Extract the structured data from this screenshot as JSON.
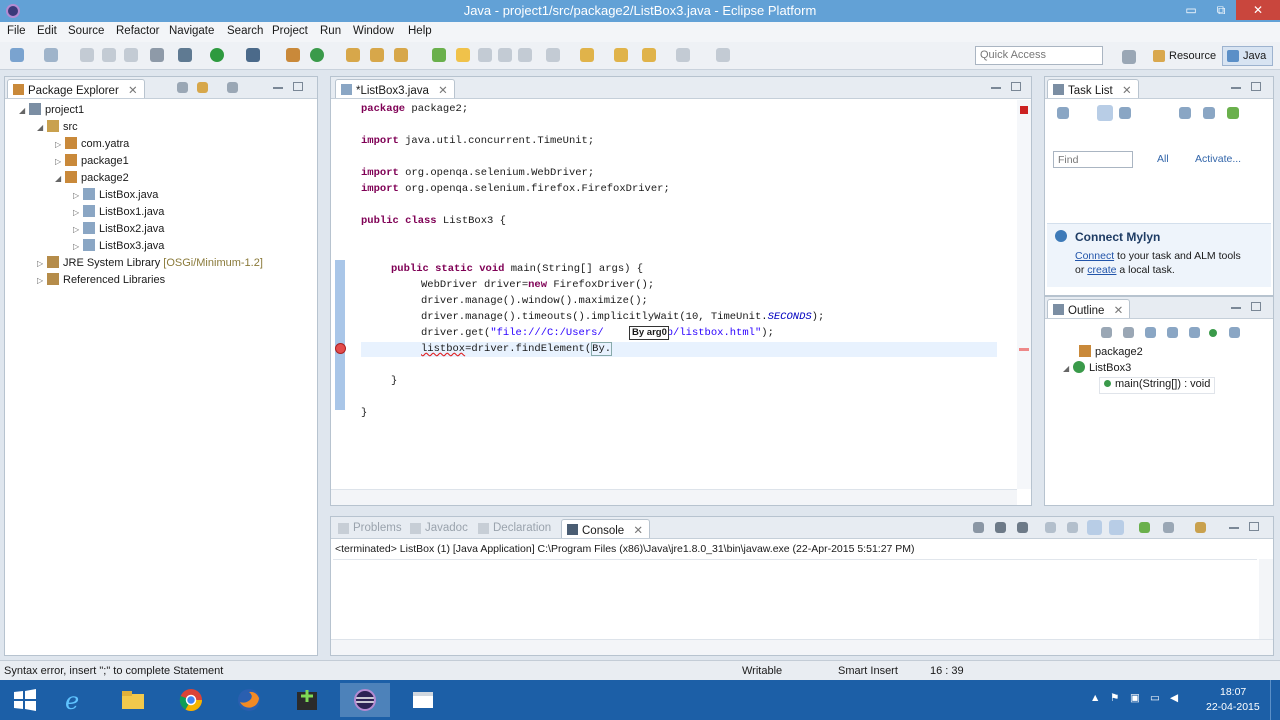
{
  "window": {
    "title": "Java - project1/src/package2/ListBox3.java - Eclipse Platform",
    "minimize": "▭",
    "maximize": "⧉",
    "close": "✕"
  },
  "menu": [
    "File",
    "Edit",
    "Source",
    "Refactor",
    "Navigate",
    "Search",
    "Project",
    "Run",
    "Window",
    "Help"
  ],
  "toolbar": {
    "quick_access_placeholder": "Quick Access",
    "perspectives": [
      "Resource",
      "Java"
    ]
  },
  "package_explorer": {
    "title": "Package Explorer",
    "tree": [
      {
        "label": "project1",
        "arrow": "◢"
      },
      {
        "label": "src",
        "arrow": "◢"
      },
      {
        "label": "com.yatra",
        "arrow": "▷"
      },
      {
        "label": "package1",
        "arrow": "▷"
      },
      {
        "label": "package2",
        "arrow": "◢"
      },
      {
        "label": "ListBox.java",
        "arrow": "▷"
      },
      {
        "label": "ListBox1.java",
        "arrow": "▷"
      },
      {
        "label": "ListBox2.java",
        "arrow": "▷"
      },
      {
        "label": "ListBox3.java",
        "arrow": "▷"
      },
      {
        "label": "JRE System Library",
        "decoration": "[OSGi/Minimum-1.2]",
        "arrow": "▷"
      },
      {
        "label": "Referenced Libraries",
        "arrow": "▷"
      }
    ]
  },
  "editor": {
    "tab_label": "*ListBox3.java",
    "code": [
      {
        "kw": "package",
        "rest": " package2;"
      },
      {
        "kw": "import",
        "rest": " java.util.concurrent.TimeUnit;"
      },
      {
        "kw": "import",
        "rest": " org.openqa.selenium.WebDriver;"
      },
      {
        "kw": "import",
        "rest": " org.openqa.selenium.firefox.FirefoxDriver;"
      },
      {
        "kw": "public class",
        "rest": " ListBox3 {"
      },
      {
        "kw": "public static void",
        "rest": " main(String[] args) {"
      },
      {
        "pre": "WebDriver driver=",
        "kw": "new",
        "rest": " FirefoxDriver();"
      },
      {
        "pre": "driver.manage().window().maximize();"
      },
      {
        "pre": "driver.manage().timeouts().implicitlyWait(10, TimeUnit.",
        "ital": "SECONDS",
        "rest": ");"
      },
      {
        "pre": "driver.get(",
        "str": "\"file:///C:/Users/    Desktop/listbox.html\"",
        "rest": ");"
      },
      {
        "err": "listbox",
        "pre": "=driver.findElement(",
        "rest": "By."
      },
      {
        "pre": "}"
      },
      {
        "pre": "}"
      }
    ],
    "tooltip": "By arg0",
    "error_marker": "✕"
  },
  "task_list": {
    "title": "Task List",
    "find_placeholder": "Find",
    "all_label": "All",
    "activate_label": "Activate...",
    "mylyn_title": "Connect Mylyn",
    "mylyn_line1_link": "Connect",
    "mylyn_line1_rest": " to your task and ALM tools",
    "mylyn_line2_pre": "or ",
    "mylyn_line2_link": "create",
    "mylyn_line2_rest": " a local task."
  },
  "outline": {
    "title": "Outline",
    "items": [
      "package2",
      "ListBox3",
      "main(String[]) : void"
    ]
  },
  "console": {
    "tabs": [
      "Problems",
      "Javadoc",
      "Declaration",
      "Console"
    ],
    "status": "<terminated> ListBox (1) [Java Application] C:\\Program Files (x86)\\Java\\jre1.8.0_31\\bin\\javaw.exe (22-Apr-2015 5:51:27 PM)"
  },
  "statusbar": {
    "message": "Syntax error, insert \";\" to complete Statement",
    "writable": "Writable",
    "insert_mode": "Smart Insert",
    "position": "16 : 39"
  },
  "taskbar": {
    "time": "18:07",
    "date": "22-04-2015"
  },
  "colors": {
    "titlebar": "#62a1d6",
    "taskbar": "#1c5fa7",
    "keyword": "#7f0055",
    "string": "#2a00ff"
  }
}
